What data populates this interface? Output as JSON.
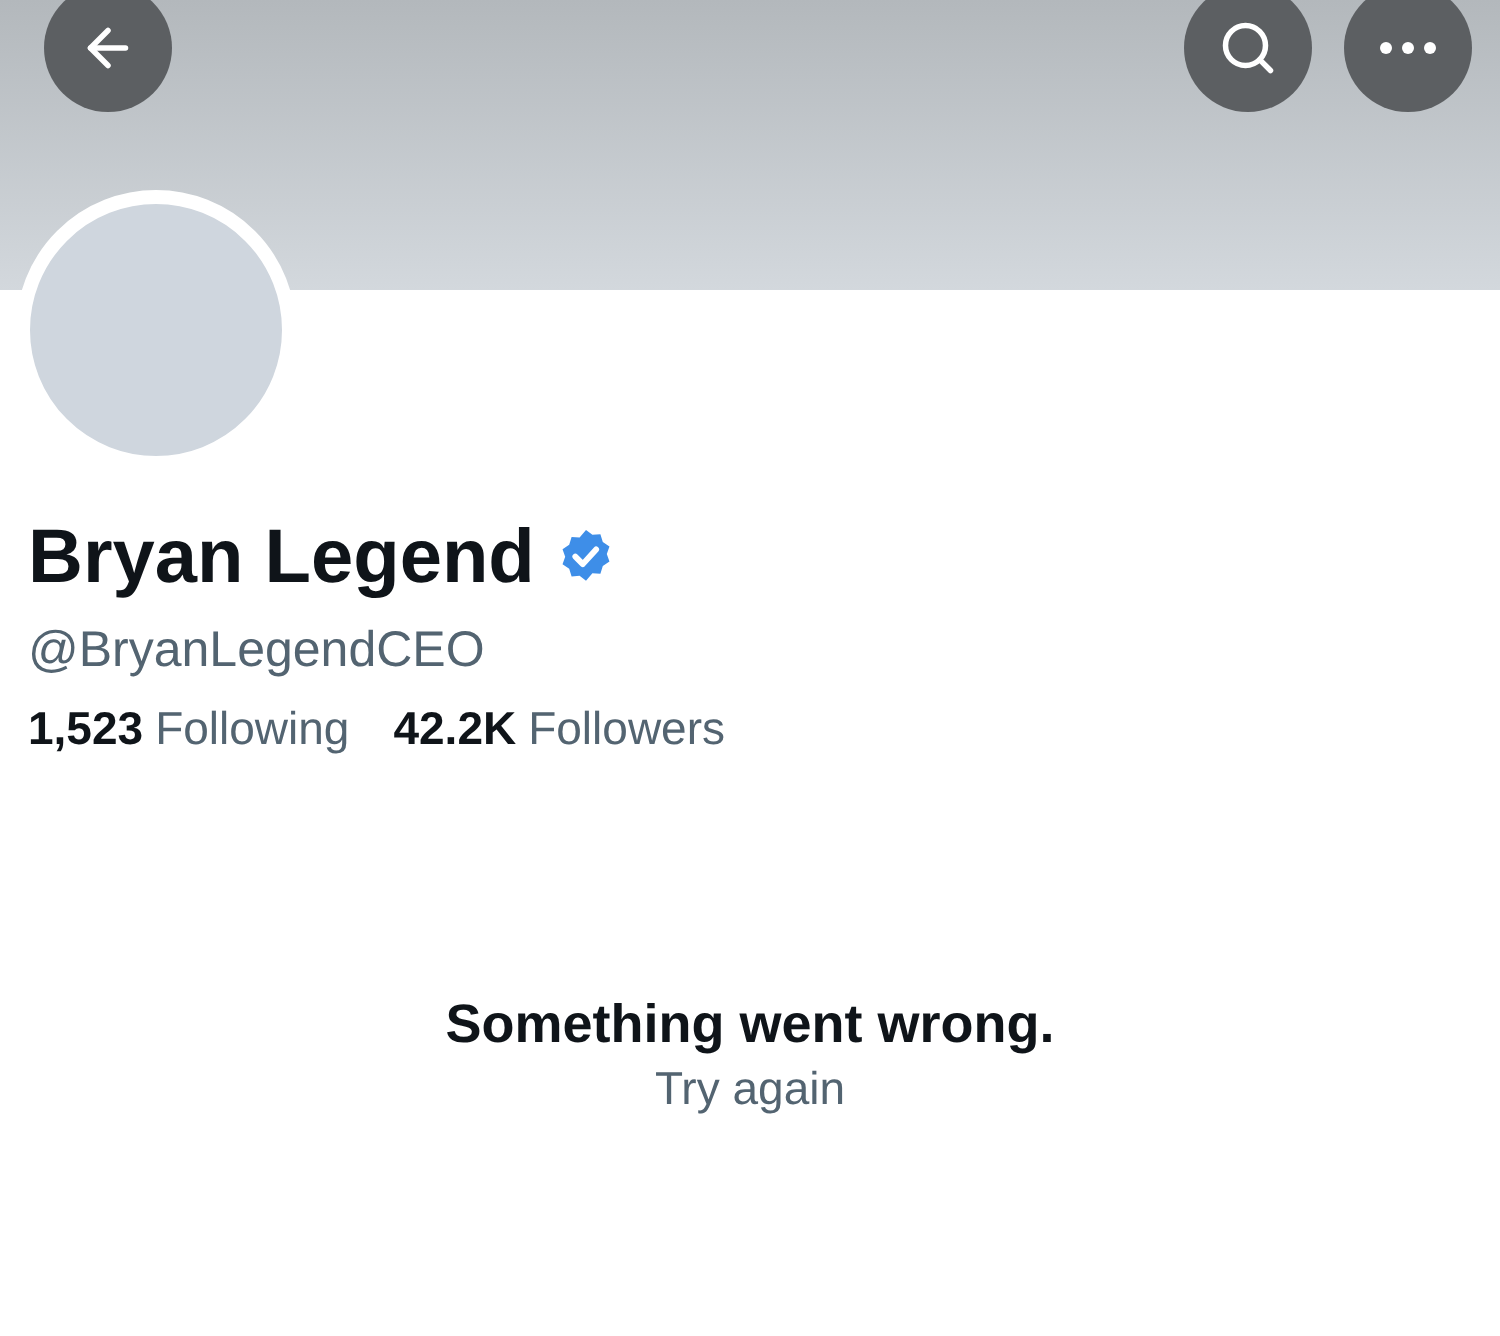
{
  "profile": {
    "name": "Bryan Legend",
    "verified": true,
    "handle": "@BryanLegendCEO"
  },
  "stats": [
    {
      "count": "1,523",
      "caption": "Following"
    },
    {
      "count": "42.2K",
      "caption": "Followers"
    }
  ],
  "error": {
    "message": "Something went wrong.",
    "action": "Try again"
  }
}
